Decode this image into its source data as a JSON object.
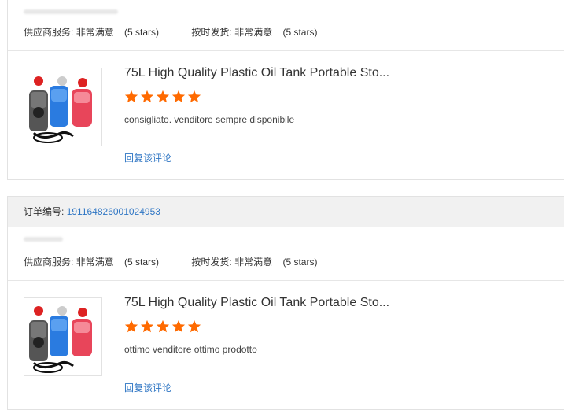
{
  "star_color": "#ff6a00",
  "link_color": "#2f76c4",
  "reviews": [
    {
      "ratings": {
        "service_label": "供应商服务:",
        "service_value": "非常满意",
        "service_stars": "(5 stars)",
        "shipping_label": "按时发货:",
        "shipping_value": "非常满意",
        "shipping_stars": "(5 stars)"
      },
      "product_title": "75L High Quality Plastic Oil Tank Portable Sto...",
      "product_stars": 5,
      "comment": "consigliato. venditore sempre disponibile",
      "reply_label": "回复该评论"
    },
    {
      "order_label": "订单编号:",
      "order_number": "191164826001024953",
      "ratings": {
        "service_label": "供应商服务:",
        "service_value": "非常满意",
        "service_stars": "(5 stars)",
        "shipping_label": "按时发货:",
        "shipping_value": "非常满意",
        "shipping_stars": "(5 stars)"
      },
      "product_title": "75L High Quality Plastic Oil Tank Portable Sto...",
      "product_stars": 5,
      "comment": "ottimo venditore ottimo prodotto",
      "reply_label": "回复该评论"
    }
  ]
}
